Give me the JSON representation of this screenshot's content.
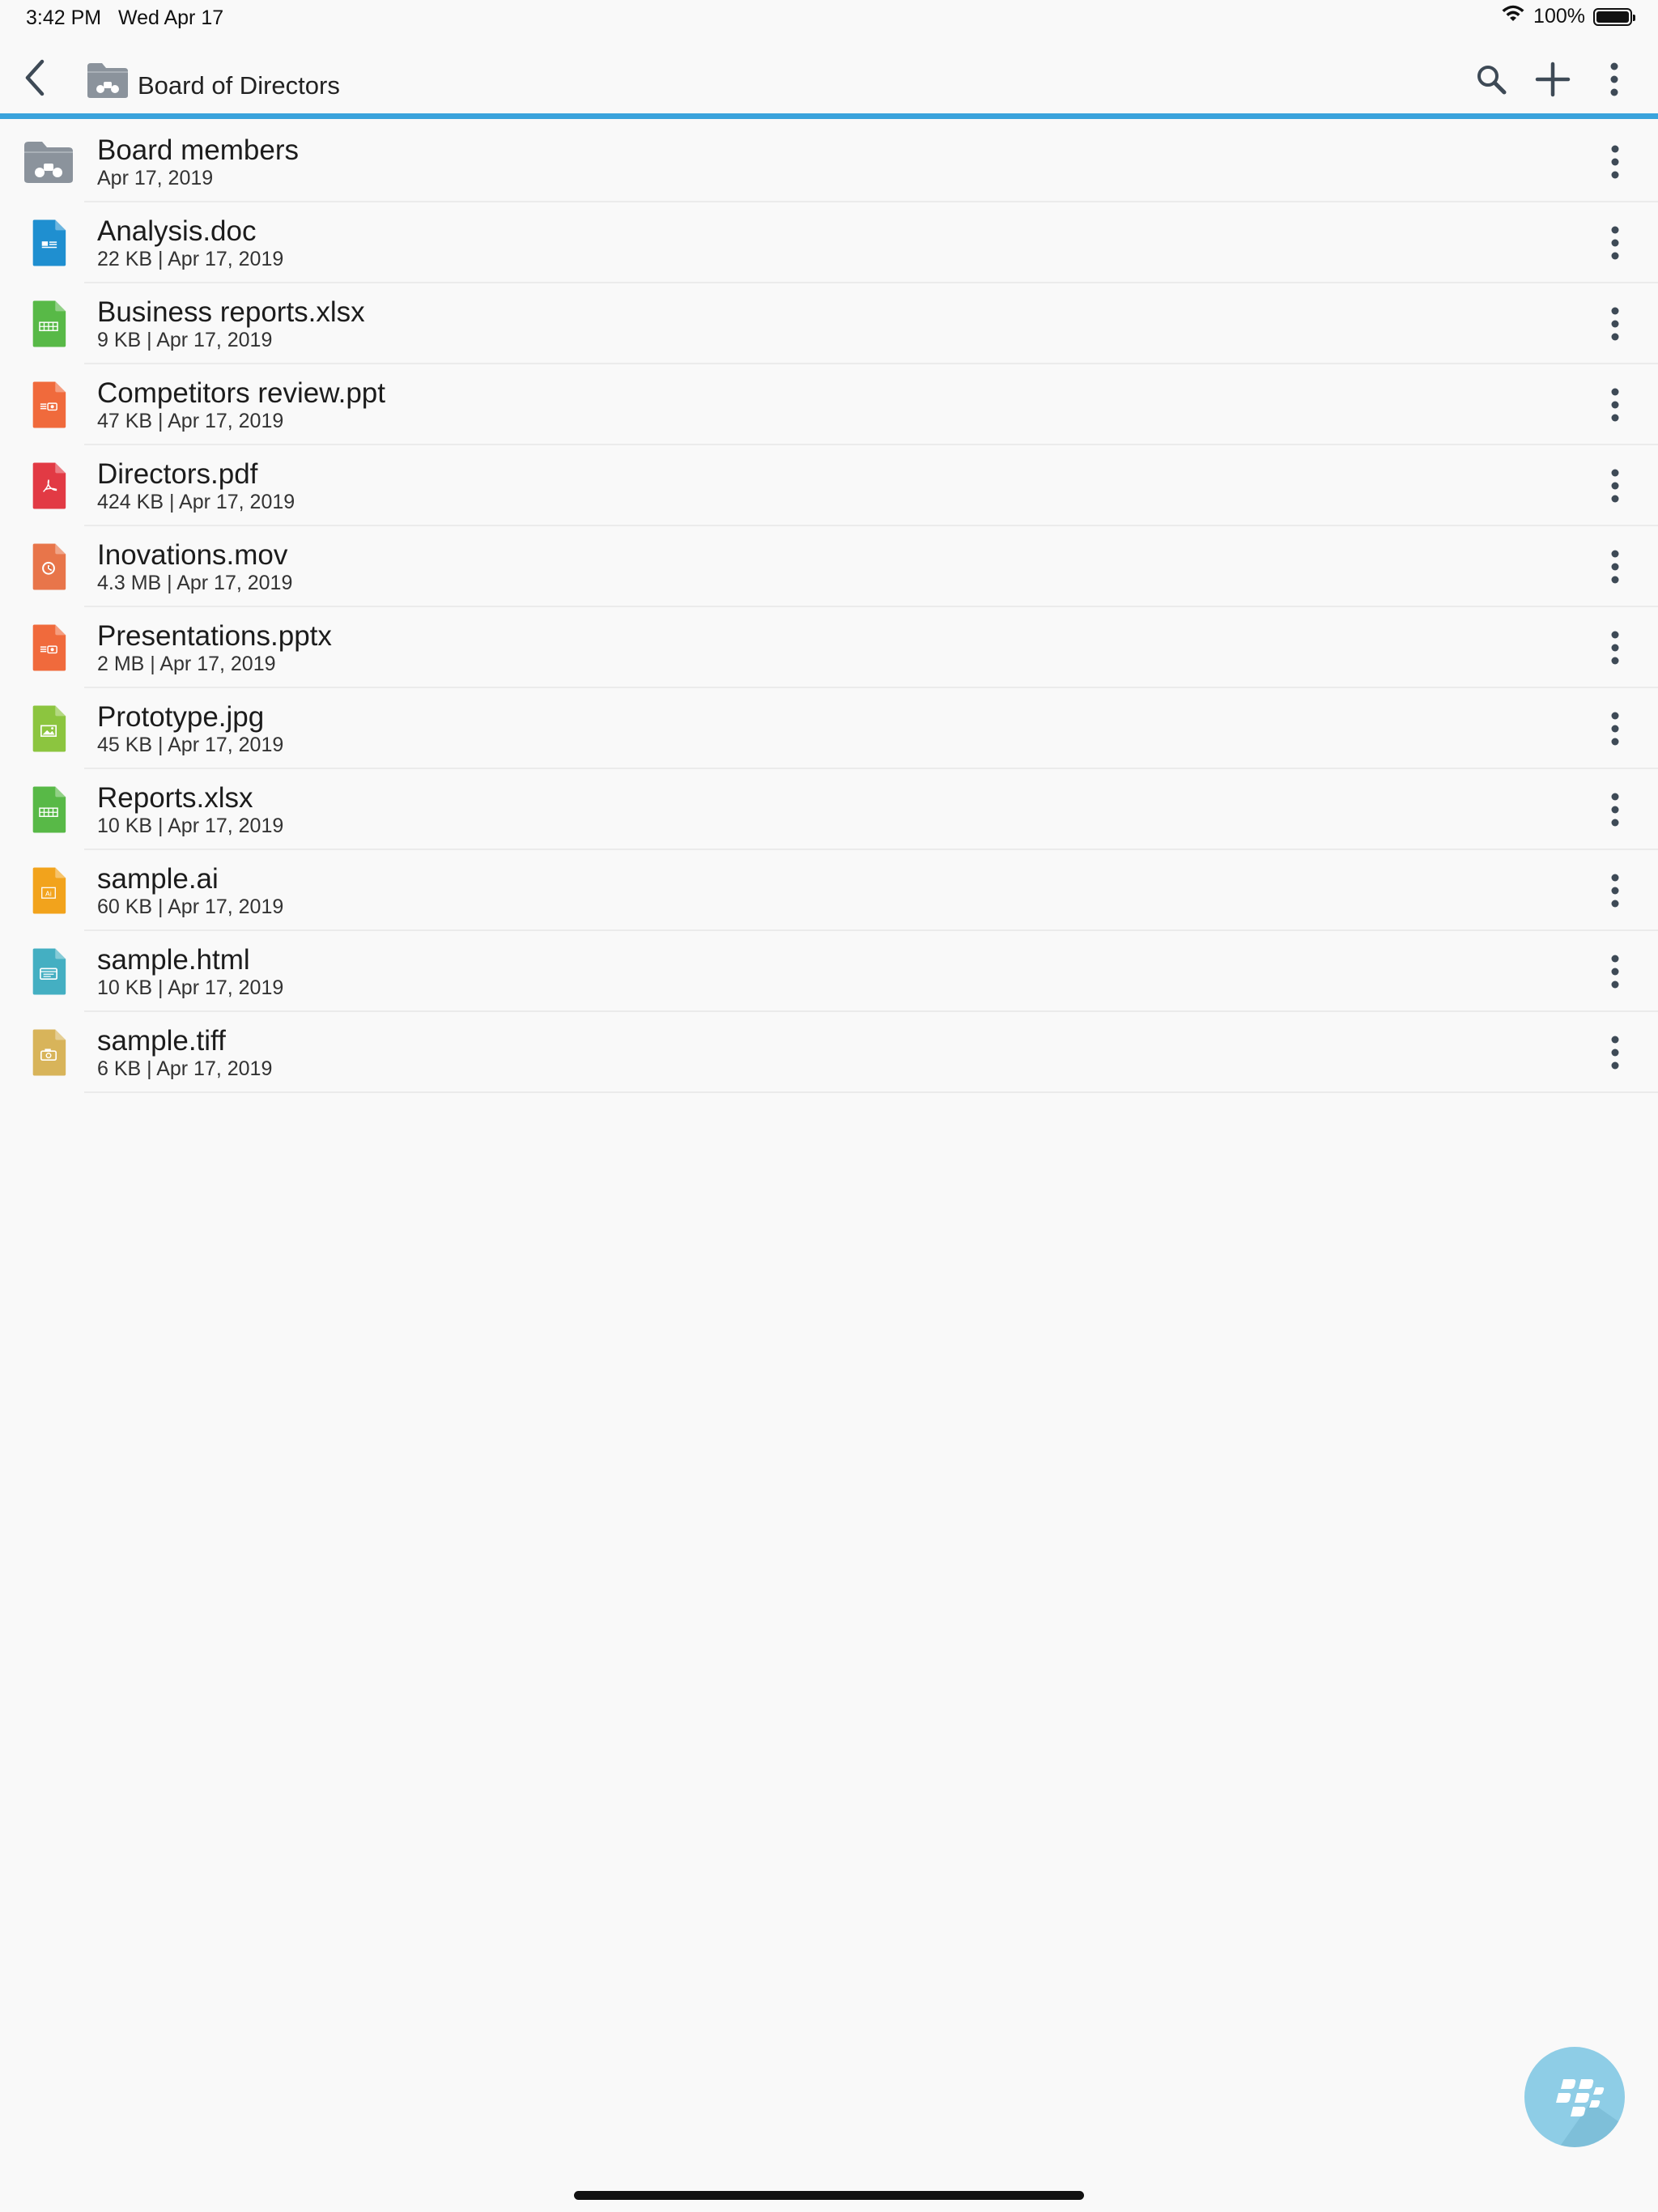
{
  "status": {
    "time": "3:42 PM",
    "date": "Wed Apr 17",
    "battery": "100%"
  },
  "nav": {
    "title": "Board of Directors"
  },
  "colors": {
    "accent": "#3aa3dc",
    "folder": "#8b939c",
    "doc": "#1f8fd0",
    "xlsx": "#58b947",
    "ppt": "#f06a3c",
    "pdf": "#e23a44",
    "mov": "#e8754a",
    "jpg": "#8cc53f",
    "ai": "#f2a31c",
    "html": "#44afc2",
    "tiff": "#d8b45a"
  },
  "items": [
    {
      "name": "Board members",
      "meta": "Apr 17, 2019",
      "icon": "shared-folder-icon",
      "color": "#8b939c",
      "kind": "folder"
    },
    {
      "name": "Analysis.doc",
      "meta": "22 KB | Apr 17, 2019",
      "icon": "doc-file-icon",
      "color": "#1f8fd0",
      "kind": "doc"
    },
    {
      "name": "Business reports.xlsx",
      "meta": "9 KB | Apr 17, 2019",
      "icon": "spreadsheet-file-icon",
      "color": "#58b947",
      "kind": "xlsx"
    },
    {
      "name": "Competitors review.ppt",
      "meta": "47 KB | Apr 17, 2019",
      "icon": "presentation-file-icon",
      "color": "#f06a3c",
      "kind": "ppt"
    },
    {
      "name": "Directors.pdf",
      "meta": "424 KB | Apr 17, 2019",
      "icon": "pdf-file-icon",
      "color": "#e23a44",
      "kind": "pdf"
    },
    {
      "name": "Inovations.mov",
      "meta": "4.3 MB | Apr 17, 2019",
      "icon": "video-file-icon",
      "color": "#e8754a",
      "kind": "mov"
    },
    {
      "name": "Presentations.pptx",
      "meta": "2 MB | Apr 17, 2019",
      "icon": "presentation-file-icon",
      "color": "#f06a3c",
      "kind": "ppt"
    },
    {
      "name": "Prototype.jpg",
      "meta": "45 KB | Apr 17, 2019",
      "icon": "image-file-icon",
      "color": "#8cc53f",
      "kind": "jpg"
    },
    {
      "name": "Reports.xlsx",
      "meta": "10 KB | Apr 17, 2019",
      "icon": "spreadsheet-file-icon",
      "color": "#58b947",
      "kind": "xlsx"
    },
    {
      "name": "sample.ai",
      "meta": "60 KB | Apr 17, 2019",
      "icon": "illustrator-file-icon",
      "color": "#f2a31c",
      "kind": "ai"
    },
    {
      "name": "sample.html",
      "meta": "10 KB | Apr 17, 2019",
      "icon": "html-file-icon",
      "color": "#44afc2",
      "kind": "html"
    },
    {
      "name": "sample.tiff",
      "meta": "6 KB | Apr 17, 2019",
      "icon": "camera-file-icon",
      "color": "#d8b45a",
      "kind": "tiff"
    }
  ]
}
